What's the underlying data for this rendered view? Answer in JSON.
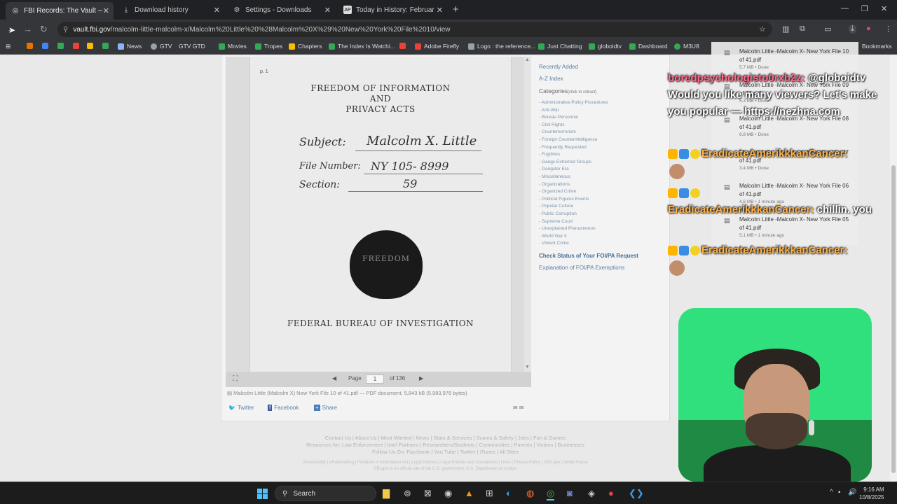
{
  "browser": {
    "tabs": [
      {
        "label": "FBI Records: The Vault — Malc",
        "icon": "fbi-favicon",
        "active": true
      },
      {
        "label": "Download history",
        "icon": "download-icon",
        "active": false
      },
      {
        "label": "Settings - Downloads",
        "icon": "gear-icon",
        "active": false
      },
      {
        "label": "Today in History: February 21, N",
        "icon": "ap-favicon",
        "active": false
      }
    ],
    "url_host": "vault.fbi.gov",
    "url_path": "/malcolm-little-malcolm-x/Malcolm%20Little%20%28Malcolm%20X%29%20New%20York%20File%2010/view",
    "bookmarks": [
      {
        "label": "News",
        "color": "#8ab4f8"
      },
      {
        "label": "GTV",
        "color": "#9aa0a6"
      },
      {
        "label": "GTV GTD",
        "color": "#9aa0a6"
      },
      {
        "label": "Movies",
        "color": "#34a853"
      },
      {
        "label": "Tropes",
        "color": "#34a853"
      },
      {
        "label": "Chapters",
        "color": "#fbbc04"
      },
      {
        "label": "The Index Is Watchi...",
        "color": "#34a853"
      },
      {
        "label": "Adobe Firefly",
        "color": "#ea4335"
      },
      {
        "label": "Logo : the reference...",
        "color": "#9aa0a6"
      },
      {
        "label": "Just Chatting",
        "color": "#34a853"
      },
      {
        "label": "globoidtv",
        "color": "#34a853"
      },
      {
        "label": "Dashboard",
        "color": "#34a853"
      },
      {
        "label": "M3U8",
        "color": "#34a853"
      },
      {
        "label": "Bookmarks",
        "color": "#9aa0a6"
      }
    ]
  },
  "document": {
    "page_marker": "p. 1",
    "title_line1": "FREEDOM OF INFORMATION",
    "title_line2": "AND",
    "title_line3": "PRIVACY ACTS",
    "subject_label": "Subject:",
    "subject_value": "Malcolm X. Little",
    "file_label": "File Number:",
    "file_value": "NY 105- 8999",
    "section_label": "Section:",
    "section_value": "59",
    "seal_text": "FREEDOM",
    "footer_title": "FEDERAL BUREAU OF INVESTIGATION"
  },
  "pager": {
    "page_label": "Page",
    "page_value": "1",
    "of_label": "of 136"
  },
  "docinfo": "Malcolm Little (Malcolm X) New York File 10 of 41.pdf — PDF document, 5,843 kB (5,983,976 bytes)",
  "share": {
    "twitter": "Twitter",
    "facebook": "Facebook",
    "share": "Share"
  },
  "sidebar": {
    "recently_added": "Recently Added",
    "az_index": "A-Z Index",
    "categories": "Categories",
    "categories_hint": "(click to retract)",
    "items": [
      "- Administrative Policy Procedures",
      "- Anti-War",
      "- Bureau Personnel",
      "- Civil Rights",
      "- Counterterrorism",
      "- Foreign Counterintelligence",
      "- Frequently Requested",
      "- Fugitives",
      "- Gangs Extremist Groups",
      "- Gangster Era",
      "- Miscellaneous",
      "- Organizations",
      "- Organized Crime",
      "- Political Figures Events",
      "- Popular Culture",
      "- Public Corruption",
      "- Supreme Court",
      "- Unexplained Phenomenon",
      "- World War II",
      "- Violent Crime"
    ],
    "check_status": "Check Status of Your FOI/PA Request",
    "explanation": "Explanation of FOI/PA Exemptions"
  },
  "footer": {
    "line1": "Contact Us | About Us | Most Wanted | News | Stats & Services | Scams & Safety | Jobs | Fun & Games",
    "line2": "Resources for: Law Enforcement | Intel Partners | Researchers/Students | Communities | Parents | Victims | Businesses",
    "line3": "Follow Us On: Facebook | You Tube | Twitter | iTunes | All Sites",
    "line4": "Accessibility | eRulemaking | Freedom of Information Act | Legal Notices | Legal Policies and Disclaimers | Links | Privacy Policy | USA.gov | White House",
    "line5": "FBI.gov is an official site of the U.S. government, U.S. Department of Justice"
  },
  "downloads": [
    {
      "name": "Malcolm Little -Malcolm X- New York File 10 of 41.pdf",
      "meta": "5.7 MB • Done"
    },
    {
      "name": "Malcolm Little -Malcolm X- New York File 09 of 41.pdf",
      "meta": "5.3 MB • Done"
    },
    {
      "name": "Malcolm Little -Malcolm X- New York File 08 of 41.pdf",
      "meta": "6.8 MB • Done"
    },
    {
      "name": "Malcolm Little -Malcolm X- New York File 07 of 41.pdf",
      "meta": "3.4 MB • Done"
    },
    {
      "name": "Malcolm Little -Malcolm X- New York File 06 of 41.pdf",
      "meta": "4.6 MB • 1 minute ago"
    },
    {
      "name": "Malcolm Little -Malcolm X- New York File 05 of 41.pdf",
      "meta": "5.1 MB • 1 minute ago"
    }
  ],
  "chat": [
    {
      "user": "boredpsychologisto0rxb2z:",
      "text": "@globoidtv Would you like many viewers? Let's make you popular — https://nezhna.com"
    },
    {
      "user": "EradicateAmerikkkanCancer:",
      "text": ""
    },
    {
      "user": "EradicateAmerikkkanCancer:",
      "text": "chillin. you"
    },
    {
      "user": "EradicateAmerikkkanCancer:",
      "text": ""
    }
  ],
  "taskbar": {
    "search_label": "Search",
    "time": "9:16 AM",
    "date": "10/8/2025"
  }
}
